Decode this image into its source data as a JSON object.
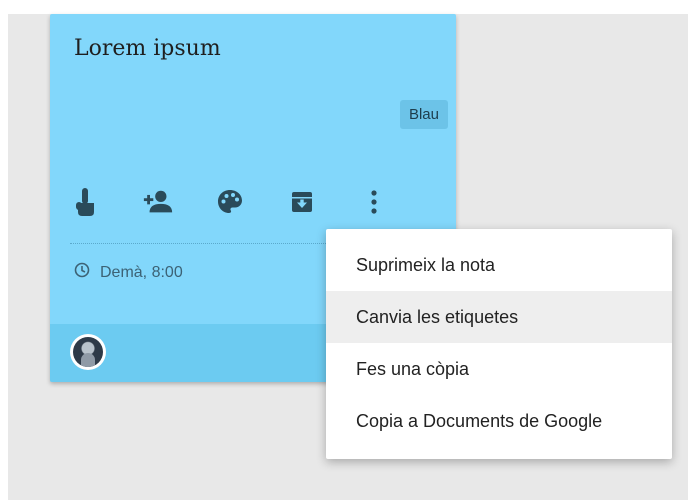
{
  "note": {
    "title": "Lorem ipsum",
    "label": "Blau",
    "reminder": "Demà, 8:00",
    "color": "#82d7fb",
    "footer_color": "#6ccbf1"
  },
  "toolbar": {
    "icons": [
      "remind-me-icon",
      "collaborator-icon",
      "change-color-icon",
      "archive-icon",
      "more-icon"
    ]
  },
  "menu": {
    "items": [
      {
        "label": "Suprimeix la nota"
      },
      {
        "label": "Canvia les etiquetes",
        "highlighted": true
      },
      {
        "label": "Fes una còpia"
      },
      {
        "label": "Copia a Documents de Google"
      }
    ]
  }
}
